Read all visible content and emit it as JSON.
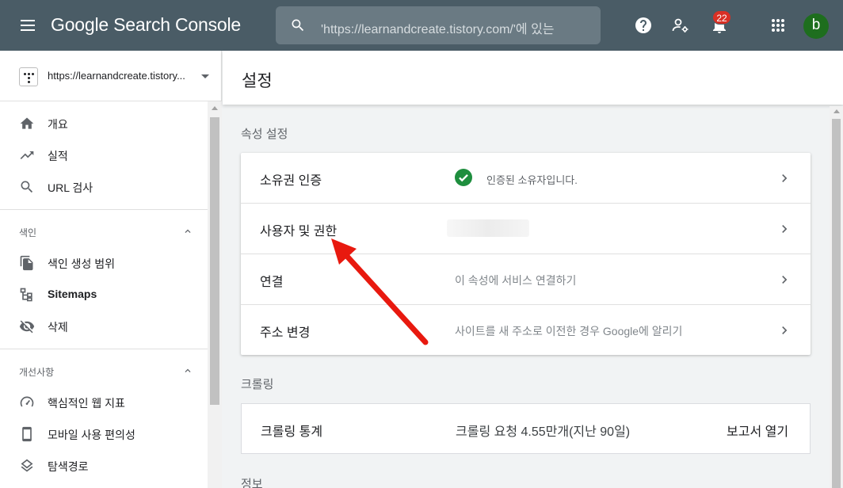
{
  "topbar": {
    "logo": "Google Search Console",
    "search_placeholder": "'https://learnandcreate.tistory.com/'에 있는",
    "notification_count": "22",
    "avatar_letter": "b"
  },
  "sidebar": {
    "property": "https://learnandcreate.tistory...",
    "items_top": [
      {
        "label": "개요",
        "icon": "home-icon"
      },
      {
        "label": "실적",
        "icon": "trending-up-icon"
      },
      {
        "label": "URL 검사",
        "icon": "search-icon"
      }
    ],
    "section_index": {
      "title": "색인",
      "items": [
        {
          "label": "색인 생성 범위",
          "icon": "file-copy-icon"
        },
        {
          "label": "Sitemaps",
          "icon": "sitemap-icon"
        },
        {
          "label": "삭제",
          "icon": "visibility-off-icon"
        }
      ]
    },
    "section_enhancements": {
      "title": "개선사항",
      "items": [
        {
          "label": "핵심적인 웹 지표",
          "icon": "speed-gauge-icon"
        },
        {
          "label": "모바일 사용 편의성",
          "icon": "smartphone-icon"
        },
        {
          "label": "탐색경로",
          "icon": "layers-icon"
        }
      ]
    }
  },
  "main": {
    "title": "설정",
    "property_settings": {
      "heading": "속성 설정",
      "rows": [
        {
          "label": "소유권 인증",
          "value": "인증된 소유자입니다."
        },
        {
          "label": "사용자 및 권한",
          "value": ""
        },
        {
          "label": "연결",
          "value": "이 속성에 서비스 연결하기"
        },
        {
          "label": "주소 변경",
          "value": "사이트를 새 주소로 이전한 경우 Google에 알리기"
        }
      ]
    },
    "crawling": {
      "heading": "크롤링",
      "label": "크롤링 통계",
      "value": "크롤링 요청 4.55만개(지난 90일)",
      "link": "보고서 열기"
    },
    "info_heading": "정보"
  },
  "colors": {
    "topbar": "#4a5c66",
    "badge": "#d93025",
    "verified": "#1e8e3e",
    "annotation_arrow": "#e8190f"
  }
}
